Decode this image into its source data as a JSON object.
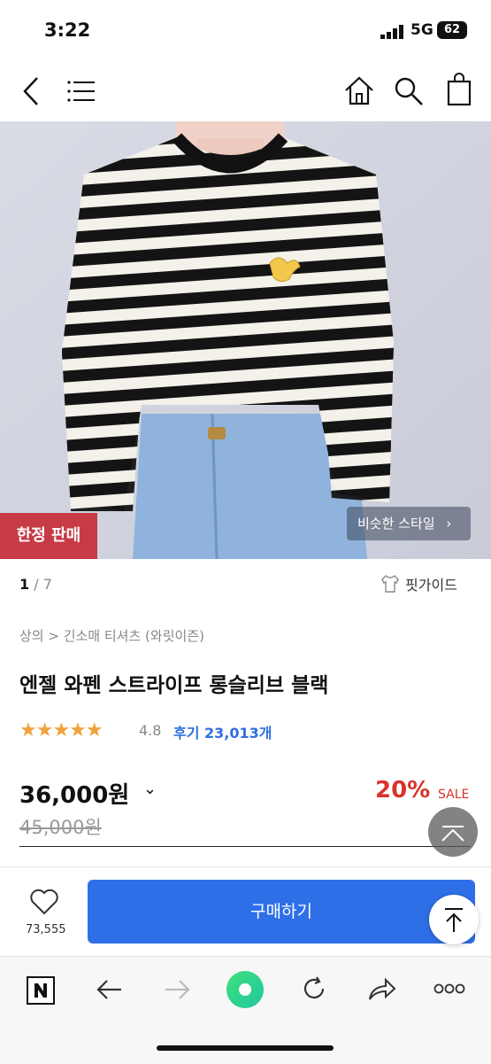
{
  "status_bar": {
    "time": "3:22",
    "network": "5G",
    "battery": "62"
  },
  "hero": {
    "badge": "한정 판매",
    "similar_style": "비슷한 스타일"
  },
  "gallery": {
    "current": "1",
    "separator": "/",
    "total": "7"
  },
  "fit_guide": "핏가이드",
  "breadcrumb": "상의 > 긴소매 티셔츠 (와릿이즌)",
  "product": {
    "title": "엔젤 와펜 스트라이프 롱슬리브 블랙",
    "stars": "★★★★★",
    "rating": "4.8",
    "reviews": "후기 23,013개",
    "price": "36,000원",
    "discount": "20%",
    "sale_label": "SALE",
    "original_price": "45,000원"
  },
  "buy_bar": {
    "like_count": "73,555",
    "buy_label": "구매하기"
  },
  "colors": {
    "buy_button": "#2e6fe8",
    "discount": "#d8332d",
    "badge": "#c73b46",
    "stars": "#f0a23c"
  }
}
